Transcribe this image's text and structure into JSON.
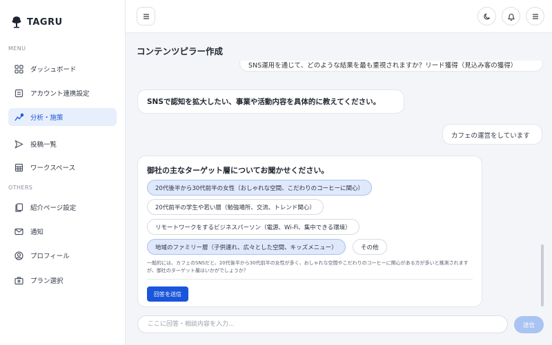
{
  "brand": {
    "name": "TAGRU"
  },
  "sidebar": {
    "menu_label": "MENU",
    "others_label": "OTHERS",
    "menu_items": [
      {
        "label": "ダッシュボード",
        "icon": "grid-icon"
      },
      {
        "label": "アカウント連携設定",
        "icon": "document-icon"
      },
      {
        "label": "分析・施策",
        "icon": "trend-chart-icon",
        "active": true
      },
      {
        "label": "投稿一覧",
        "icon": "send-icon"
      },
      {
        "label": "ワークスペース",
        "icon": "table-icon"
      }
    ],
    "other_items": [
      {
        "label": "紹介ページ設定",
        "icon": "pages-icon"
      },
      {
        "label": "通知",
        "icon": "mail-icon"
      },
      {
        "label": "プロフィール",
        "icon": "user-circle-icon"
      },
      {
        "label": "プラン選択",
        "icon": "briefcase-icon"
      }
    ]
  },
  "page": {
    "title": "コンテンツピラー作成"
  },
  "chat": {
    "cut_message": "SNS運用を通じて、どのような結果を最も重視されますか？リード獲得（見込み客の獲得）",
    "question": "SNSで認知を拡大したい、事業や活動内容を具体的に教えてください。",
    "answer": "カフェの運営をしています",
    "card": {
      "title": "御社の主なターゲット層についてお聞かせください。",
      "options": [
        {
          "label": "20代後半から30代前半の女性（おしゃれな空間、こだわりのコーヒーに関心）",
          "selected": true
        },
        {
          "label": "20代前半の学生や若い層（勉強場所、交流、トレンド関心）",
          "selected": false
        },
        {
          "label": "リモートワークをするビジネスパーソン（電源、Wi-Fi、集中できる環境）",
          "selected": false
        },
        {
          "label": "地域のファミリー層（子供連れ、広々とした空間、キッズメニュー）",
          "selected": true
        },
        {
          "label": "その他",
          "selected": false
        }
      ],
      "note": "一般的には、カフェのSNSだと、20代後半から30代前半の女性が多く、おしゃれな空間やこだわりのコーヒーに関心がある方が多いと推測されますが、御社のターゲット層はいかがでしょうか？",
      "submit_label": "回答を送信"
    }
  },
  "composer": {
    "placeholder": "ここに回答・相談内容を入力...",
    "send_label": "送信"
  },
  "colors": {
    "accent": "#1a56db",
    "selected_bg": "#dfe9fb",
    "send_disabled": "#a9c3f2"
  }
}
